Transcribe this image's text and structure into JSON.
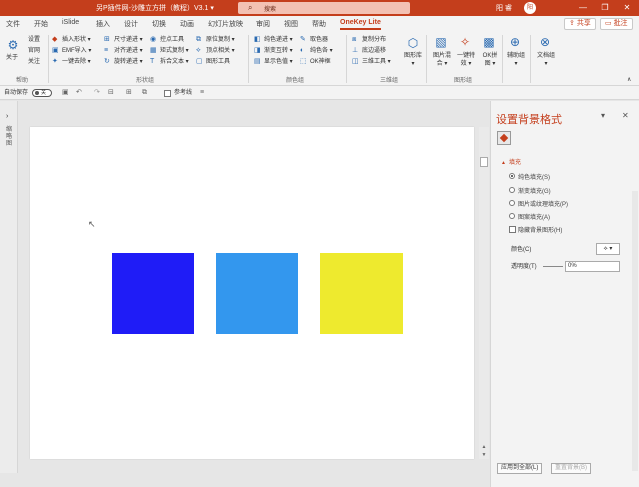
{
  "app": {
    "title": "另P插件网-沙雕立方拼（教程）V3.1 ▾",
    "search_placeholder": "搜索",
    "user_name": "阳 睿",
    "avatar_text": "阳",
    "brand_color": "#c43e1c"
  },
  "window_controls": [
    "—",
    "❐",
    "✕"
  ],
  "tabs": [
    "文件",
    "开始",
    "iSlide",
    "插入",
    "设计",
    "切换",
    "动画",
    "幻灯片放映",
    "审阅",
    "视图",
    "帮助",
    "OneKey Lite"
  ],
  "active_tab": "OneKey Lite",
  "tab_actions": {
    "share": "共享",
    "comment": "批注"
  },
  "ribbon": {
    "group1": {
      "big_label": "关于",
      "items": [
        "设置",
        "官网",
        "关注"
      ],
      "label": "帮助"
    },
    "group2": {
      "col1": [
        "插入形状 ▾",
        "EMF导入 ▾",
        "一键去除 ▾"
      ],
      "col2": [
        "尺寸递进 ▾",
        "对齐递进 ▾",
        "旋转递进 ▾"
      ],
      "col3": [
        "控点工具",
        "矩式复制 ▾",
        "拆合文本 ▾"
      ],
      "col4": [
        "原位复制 ▾",
        "顶点相关 ▾",
        "图形工具"
      ],
      "label": "形状组"
    },
    "group3": {
      "col1": [
        "纯色递进 ▾",
        "渐变互转 ▾",
        "显示色值 ▾"
      ],
      "col2": [
        "取色器",
        "纯色各 ▾",
        "OK神框"
      ],
      "label": "颜色组"
    },
    "group4": {
      "items": [
        "复制分布",
        "底边逼移",
        "三维工具 ▾"
      ],
      "big_label": "图形库 ▾",
      "label": "三维组"
    },
    "group5": {
      "items": [
        "图片混合 ▾",
        "一键特效 ▾",
        "OK拼图 ▾"
      ],
      "label": "图形组"
    },
    "group6": {
      "items": [
        "辅助组 ▾",
        "文档组 ▾"
      ]
    }
  },
  "quickbar": {
    "autosave": "自动保存",
    "toggle_state": "关",
    "reference_line": "参考线"
  },
  "rail": {
    "label": "缩略图"
  },
  "slide": {
    "shapes": [
      {
        "name": "blue-square",
        "color": "#1f1cf7"
      },
      {
        "name": "light-blue-square",
        "color": "#3397ee"
      },
      {
        "name": "yellow-square",
        "color": "#eeea2e"
      }
    ]
  },
  "pane": {
    "title": "设置背景格式",
    "section": "填充",
    "options": [
      {
        "label": "纯色填充(S)",
        "selected": true
      },
      {
        "label": "渐变填充(G)",
        "selected": false
      },
      {
        "label": "图片或纹理填充(P)",
        "selected": false
      },
      {
        "label": "图案填充(A)",
        "selected": false
      }
    ],
    "hide_bg_graphics": "隐藏背景图形(H)",
    "color_label": "颜色(C)",
    "transparency_label": "透明度(T)",
    "transparency_value": "0%",
    "apply_all": "应用到全部(L)",
    "reset": "重置背景(B)"
  }
}
